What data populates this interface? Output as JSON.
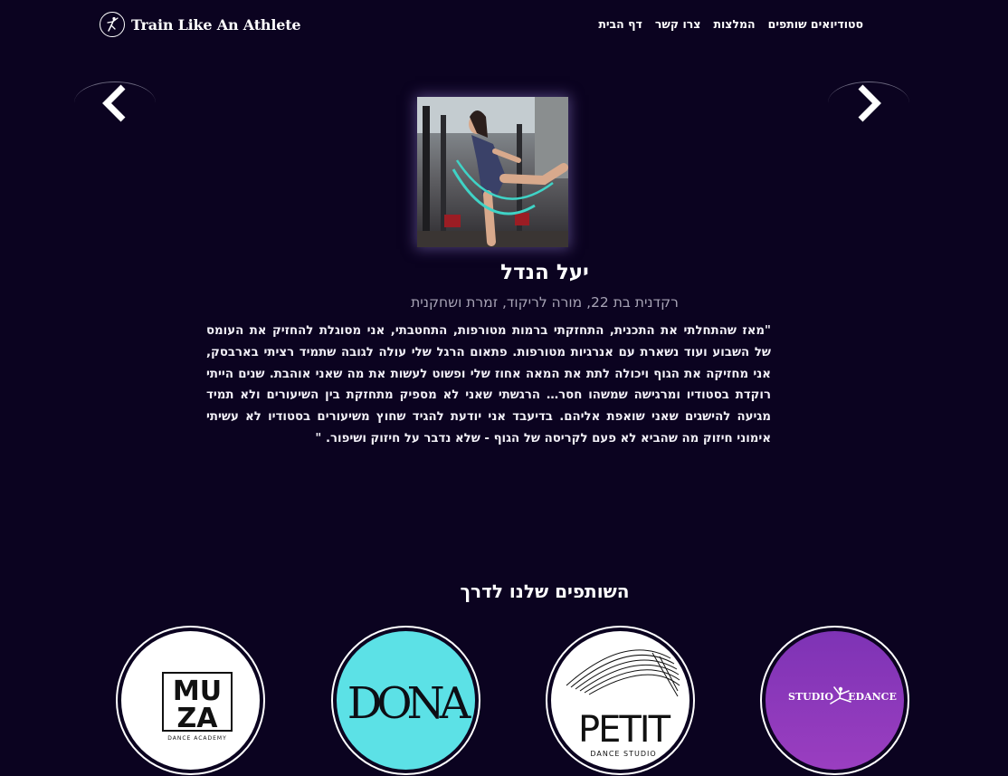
{
  "brand": {
    "name": "Train Like An Athlete"
  },
  "nav": [
    {
      "label": "דף הבית"
    },
    {
      "label": "צרו קשר"
    },
    {
      "label": "המלצות"
    },
    {
      "label": "סטודיואים שותפים"
    }
  ],
  "testimonial": {
    "name": "יעל הנדל",
    "subtitle": "רקדנית בת 22, מורה לריקוד, זמרת ושחקנית",
    "quote": "\"מאז שהתחלתי את התכנית, התחזקתי ברמות מטורפות, התחטבתי, אני מסוגלת להחזיק את העומס של השבוע ועוד נשארת עם אנרגיות מטורפות. פתאום הרגל שלי עולה לגובה שתמיד רציתי בארבסק, אני מחזיקה את הגוף ויכולה לתת את המאה אחוז שלי ופשוט לעשות את מה שאני אוהבת. שנים הייתי רוקדת בסטודיו ומרגישה שמשהו חסר… הרגשתי שאני לא מספיק מתחזקת בין השיעורים ולא תמיד מגיעה להישגים שאני שואפת אליהם. בדיעבד אני יודעת להגיד שחוץ משיעורים בסטודיו לא עשיתי אימוני חיזוק מה שהביא לא פעם לקריסה של הגוף - שלא נדבר על חיזוק ושיפור. \""
  },
  "partners": {
    "title": "השותפים שלנו לדרך",
    "logos": [
      {
        "line1": "MU",
        "line2": "ZA",
        "caption": "DANCE ACADEMY"
      },
      {
        "text": "DONA"
      },
      {
        "text": "PETIT",
        "caption": "DANCE STUDIO"
      },
      {
        "left": "STUDIO",
        "right": "EDANCE"
      }
    ]
  },
  "colors": {
    "background": "#0b0320",
    "dona_bg": "#5ce1e6",
    "studio_bg": "#8a36b8"
  },
  "icons": [
    "dancer-logo-icon",
    "chevron-left-icon",
    "chevron-right-icon"
  ]
}
